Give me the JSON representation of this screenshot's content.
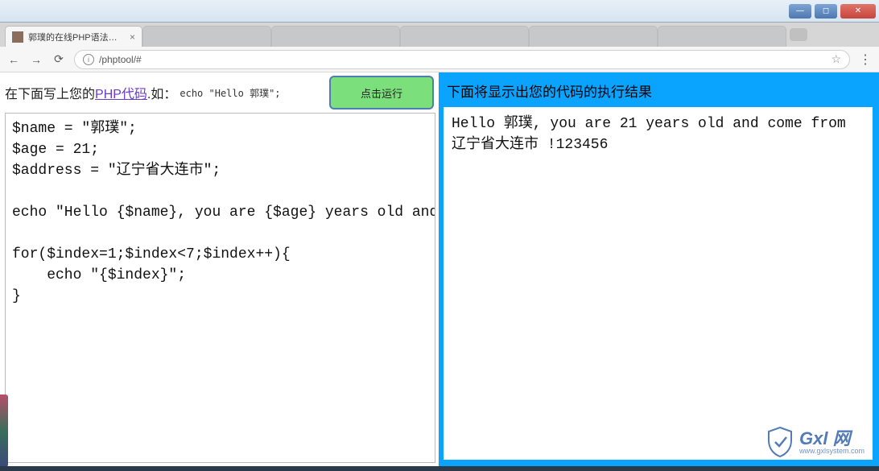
{
  "window": {
    "min_label": "—",
    "max_label": "◻",
    "close_label": "✕"
  },
  "browser": {
    "active_tab_title": "郭璞的在线PHP语法练习",
    "tab_close": "×",
    "inactive_tabs": [
      "",
      "",
      "",
      "",
      ""
    ],
    "back": "←",
    "forward": "→",
    "reload": "⟳",
    "info_icon": "i",
    "url": "/phptool/#",
    "star": "☆",
    "menu": "⋮"
  },
  "editor": {
    "instr_prefix": "在下面写上您的",
    "instr_link": "PHP代码",
    "instr_suffix": ".如：",
    "hint_code": "echo \"Hello 郭璞\";",
    "run_label": "点击运行",
    "code": "$name = \"郭璞\";\n$age = 21;\n$address = \"辽宁省大连市\";\n\necho \"Hello {$name}, you are {$age} years old and come from {$address} !\";\n\nfor($index=1;$index<7;$index++){\n    echo \"{$index}\";\n}"
  },
  "result": {
    "heading": "下面将显示出您的代码的执行结果",
    "output": "Hello 郭璞, you are 21 years old and come from 辽宁省大连市 !123456"
  },
  "watermark": {
    "brand": "Gxl 网",
    "url": "www.gxlsystem.com"
  }
}
